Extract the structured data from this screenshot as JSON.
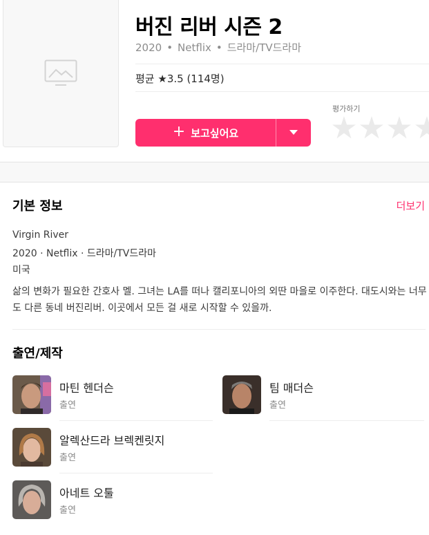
{
  "title": "버진 리버 시즌 2",
  "meta": {
    "year": "2020",
    "platform": "Netflix",
    "genre": "드라마/TV드라마",
    "separator": "•"
  },
  "rating": {
    "text": "평균 ★3.5 (114명)"
  },
  "wish_button": {
    "label": "보고싶어요",
    "plus": "+",
    "accent": "#ff2f6e"
  },
  "rate": {
    "label": "평가하기",
    "star_count": 5
  },
  "basic_info": {
    "heading": "기본 정보",
    "more": "더보기",
    "original_title": "Virgin River",
    "summary_line": "2020 · Netflix · 드라마/TV드라마",
    "country": "미국",
    "synopsis": "삶의 변화가 필요한 간호사 멜. 그녀는 LA를 떠나 캘리포니아의 외딴 마을로 이주한다. 대도시와는 너무도 다른 동네 버진리버. 이곳에서 모든 걸 새로 시작할 수 있을까."
  },
  "cast": {
    "heading": "출연/제작",
    "people": [
      {
        "name": "마틴 헨더슨",
        "role": "출연"
      },
      {
        "name": "팀 매더슨",
        "role": "출연"
      },
      {
        "name": "알렉산드라 브렉켄릿지",
        "role": "출연"
      },
      {
        "name": "아네트 오툴",
        "role": "출연"
      }
    ]
  }
}
